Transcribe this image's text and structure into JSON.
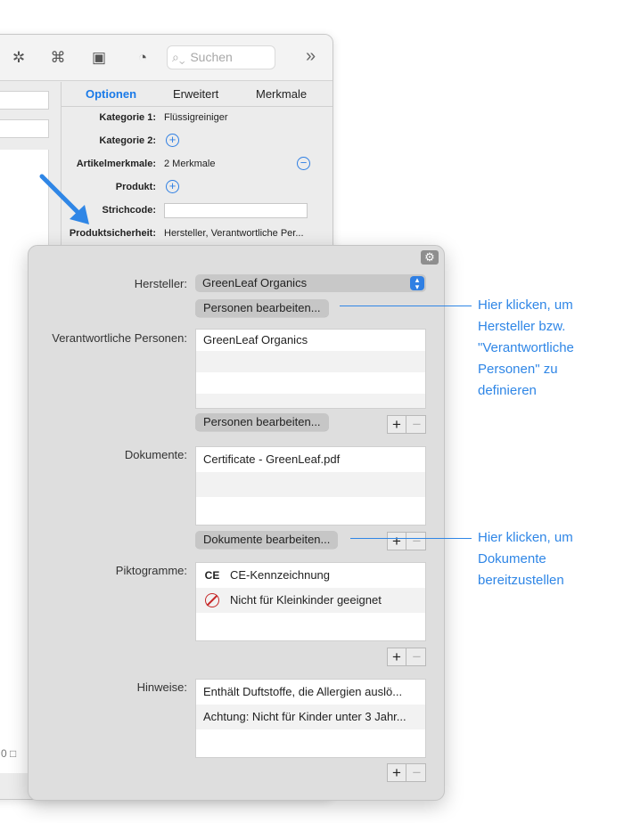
{
  "toolbar": {
    "search_placeholder": "Suchen",
    "icons": [
      "gear-badge-icon",
      "robot-icon",
      "image-icon",
      "bell-clock-icon",
      "search-icon",
      "chevron-double-right-icon"
    ]
  },
  "tabs": [
    {
      "label": "Optionen",
      "active": true
    },
    {
      "label": "Erweitert",
      "active": false
    },
    {
      "label": "Merkmale",
      "active": false
    }
  ],
  "properties": {
    "kategorie1_label": "Kategorie 1:",
    "kategorie1_value": "Flüssigreiniger",
    "kategorie2_label": "Kategorie 2:",
    "artikelmerkmale_label": "Artikelmerkmale:",
    "artikelmerkmale_value": "2 Merkmale",
    "produkt_label": "Produkt:",
    "strichcode_label": "Strichcode:",
    "produktsicherheit_label": "Produktsicherheit:",
    "produktsicherheit_value": "Hersteller, Verantwortliche Per..."
  },
  "popover": {
    "hersteller_label": "Hersteller:",
    "hersteller_value": "GreenLeaf Organics",
    "personen_bearbeiten_1": "Personen bearbeiten...",
    "verantwortliche_label": "Verantwortliche Personen:",
    "verantwortliche_items": [
      "GreenLeaf Organics"
    ],
    "personen_bearbeiten_2": "Personen bearbeiten...",
    "dokumente_label": "Dokumente:",
    "dokumente_items": [
      "Certificate - GreenLeaf.pdf"
    ],
    "dokumente_bearbeiten": "Dokumente bearbeiten...",
    "piktogramme_label": "Piktogramme:",
    "piktogramme_items": [
      {
        "icon": "ce-mark-icon",
        "symbol": "CE",
        "label": "CE-Kennzeichnung"
      },
      {
        "icon": "no-children-icon",
        "symbol": "",
        "label": "Nicht für Kleinkinder geeignet"
      }
    ],
    "hinweise_label": "Hinweise:",
    "hinweise_items": [
      "Enthält Duftstoffe, die Allergien auslö...",
      "Achtung: Nicht für Kinder unter 3 Jahr..."
    ],
    "plus": "+",
    "minus": "−"
  },
  "callouts": {
    "hersteller": "Hier klicken, um Hersteller bzw. \"Verantwortliche Personen\" zu definieren",
    "dokumente": "Hier klicken, um Dokumente bereitzustellen"
  },
  "colors": {
    "accent": "#2f7fe3",
    "callout": "#2f86e6",
    "warning_red": "#c62828"
  }
}
